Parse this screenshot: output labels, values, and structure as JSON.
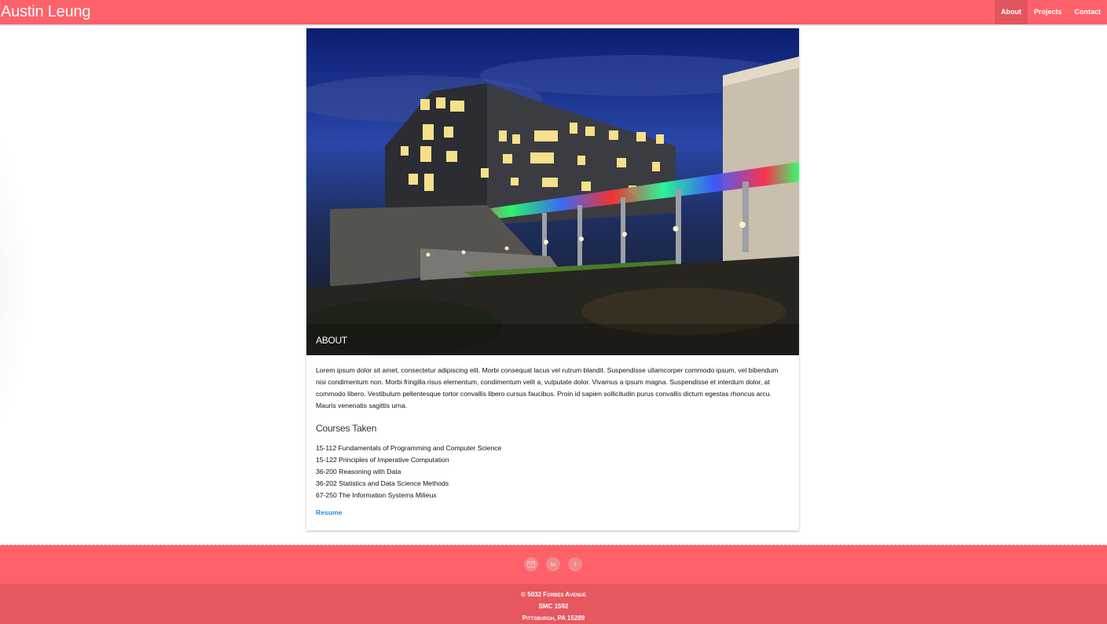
{
  "header": {
    "brand": "Austin Leung",
    "nav": [
      {
        "label": "About"
      },
      {
        "label": "Projects"
      },
      {
        "label": "Contact"
      }
    ]
  },
  "about": {
    "hero_title": "ABOUT",
    "paragraph": "Lorem ipsum dolor sit amet, consectetur adipiscing elit. Morbi consequat lacus vel rutrum blandit. Suspendisse ullamcorper commodo ipsum, vel bibendum nisi condimentum non. Morbi fringilla risus elementum, condimentum velit a, vulputate dolor. Vivamus a ipsum magna. Suspendisse et interdum dolor, at commodo libero. Vestibulum pellentesque tortor convallis libero cursus faucibus. Proin id sapien sollicitudin purus convallis dictum egestas rhoncus arcu. Mauris venenatis sagittis urna.",
    "courses_heading": "Courses Taken",
    "courses": [
      "15-112 Fundamentals of Programming and Computer Science",
      "15-122 Principles of Imperative Computation",
      "36-200 Reasoning with Data",
      "36-202 Statistics and Data Science Methods",
      "67-250 The Information Systems Milieux"
    ],
    "resume_label": "Resume"
  },
  "footer": {
    "social_icons": [
      "mail-icon",
      "linkedin-icon",
      "facebook-icon"
    ],
    "address_line1": "© 5032 Forbes Avenue",
    "address_line2": "SMC 1592",
    "address_line3": "Pittsburgh, PA 15289"
  },
  "colors": {
    "accent": "#ff616a",
    "footer_dark": "#e6575f",
    "link": "#2b8ad8"
  }
}
